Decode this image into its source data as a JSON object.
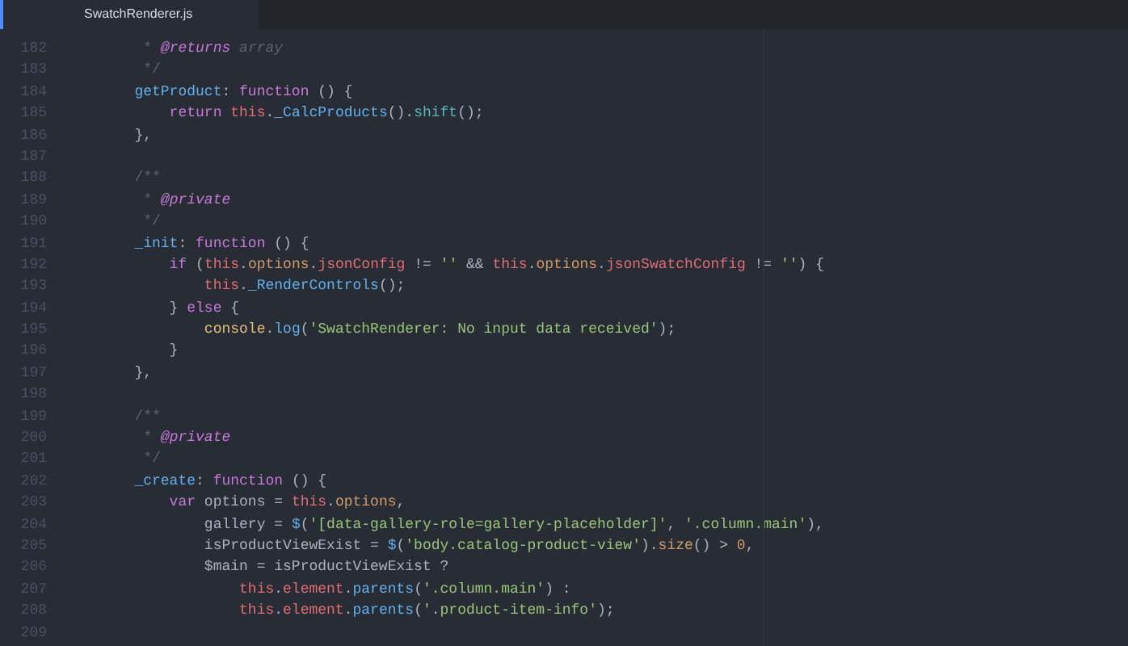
{
  "tabs": [
    {
      "label": "SwatchRenderer.js",
      "selected": true
    }
  ],
  "lines": [
    {
      "number": "182",
      "tokens": [
        {
          "kind": "comment",
          "text": "         * "
        },
        {
          "kind": "tag",
          "text": "@returns"
        },
        {
          "kind": "ctype",
          "text": " array"
        }
      ]
    },
    {
      "number": "183",
      "tokens": [
        {
          "kind": "comment",
          "text": "         */"
        }
      ]
    },
    {
      "number": "184",
      "tokens": [
        {
          "kind": "func",
          "text": "        getProduct"
        },
        {
          "kind": "plain",
          "text": ": "
        },
        {
          "kind": "keyword",
          "text": "function"
        },
        {
          "kind": "plain",
          "text": " () {"
        }
      ]
    },
    {
      "number": "185",
      "tokens": [
        {
          "kind": "keyword",
          "text": "            return "
        },
        {
          "kind": "this",
          "text": "this"
        },
        {
          "kind": "plain",
          "text": "."
        },
        {
          "kind": "func",
          "text": "_CalcProducts"
        },
        {
          "kind": "plain",
          "text": "()."
        },
        {
          "kind": "method",
          "text": "shift"
        },
        {
          "kind": "plain",
          "text": "();"
        }
      ]
    },
    {
      "number": "186",
      "tokens": [
        {
          "kind": "plain",
          "text": "        },"
        }
      ]
    },
    {
      "number": "187"
    },
    {
      "number": "188",
      "tokens": [
        {
          "kind": "comment",
          "text": "        /**"
        }
      ]
    },
    {
      "number": "189",
      "tokens": [
        {
          "kind": "comment",
          "text": "         * "
        },
        {
          "kind": "tag",
          "text": "@private"
        }
      ]
    },
    {
      "number": "190",
      "tokens": [
        {
          "kind": "comment",
          "text": "         */"
        }
      ]
    },
    {
      "number": "191",
      "tokens": [
        {
          "kind": "func",
          "text": "        _init"
        },
        {
          "kind": "plain",
          "text": ": "
        },
        {
          "kind": "keyword",
          "text": "function"
        },
        {
          "kind": "plain",
          "text": " () {"
        }
      ]
    },
    {
      "number": "192",
      "tokens": [
        {
          "kind": "keyword",
          "text": "            if"
        },
        {
          "kind": "plain",
          "text": " ("
        },
        {
          "kind": "this",
          "text": "this"
        },
        {
          "kind": "plain",
          "text": "."
        },
        {
          "kind": "var",
          "text": "options"
        },
        {
          "kind": "plain",
          "text": "."
        },
        {
          "kind": "this",
          "text": "jsonConfig"
        },
        {
          "kind": "plain",
          "text": " != "
        },
        {
          "kind": "string",
          "text": "''"
        },
        {
          "kind": "plain",
          "text": " && "
        },
        {
          "kind": "this",
          "text": "this"
        },
        {
          "kind": "plain",
          "text": "."
        },
        {
          "kind": "var",
          "text": "options"
        },
        {
          "kind": "plain",
          "text": "."
        },
        {
          "kind": "this",
          "text": "jsonSwatchConfig"
        },
        {
          "kind": "plain",
          "text": " != "
        },
        {
          "kind": "string",
          "text": "''"
        },
        {
          "kind": "plain",
          "text": ") {"
        }
      ]
    },
    {
      "number": "193",
      "tokens": [
        {
          "kind": "this",
          "text": "                this"
        },
        {
          "kind": "plain",
          "text": "."
        },
        {
          "kind": "func",
          "text": "_RenderControls"
        },
        {
          "kind": "plain",
          "text": "();"
        }
      ]
    },
    {
      "number": "194",
      "tokens": [
        {
          "kind": "plain",
          "text": "            } "
        },
        {
          "kind": "keyword",
          "text": "else"
        },
        {
          "kind": "plain",
          "text": " {"
        }
      ]
    },
    {
      "number": "195",
      "tokens": [
        {
          "kind": "object",
          "text": "                console"
        },
        {
          "kind": "plain",
          "text": "."
        },
        {
          "kind": "func",
          "text": "log"
        },
        {
          "kind": "plain",
          "text": "("
        },
        {
          "kind": "string",
          "text": "'SwatchRenderer: No input data received'"
        },
        {
          "kind": "plain",
          "text": ");"
        }
      ]
    },
    {
      "number": "196",
      "tokens": [
        {
          "kind": "plain",
          "text": "            }"
        }
      ]
    },
    {
      "number": "197",
      "tokens": [
        {
          "kind": "plain",
          "text": "        },"
        }
      ]
    },
    {
      "number": "198"
    },
    {
      "number": "199",
      "tokens": [
        {
          "kind": "comment",
          "text": "        /**"
        }
      ]
    },
    {
      "number": "200",
      "tokens": [
        {
          "kind": "comment",
          "text": "         * "
        },
        {
          "kind": "tag",
          "text": "@private"
        }
      ]
    },
    {
      "number": "201",
      "tokens": [
        {
          "kind": "comment",
          "text": "         */"
        }
      ]
    },
    {
      "number": "202",
      "tokens": [
        {
          "kind": "func",
          "text": "        _create"
        },
        {
          "kind": "plain",
          "text": ": "
        },
        {
          "kind": "keyword",
          "text": "function"
        },
        {
          "kind": "plain",
          "text": " () {"
        }
      ]
    },
    {
      "number": "203",
      "tokens": [
        {
          "kind": "keyword",
          "text": "            var"
        },
        {
          "kind": "plain",
          "text": " options = "
        },
        {
          "kind": "this",
          "text": "this"
        },
        {
          "kind": "plain",
          "text": "."
        },
        {
          "kind": "var",
          "text": "options"
        },
        {
          "kind": "plain",
          "text": ","
        }
      ]
    },
    {
      "number": "204",
      "tokens": [
        {
          "kind": "plain",
          "text": "                gallery = "
        },
        {
          "kind": "func",
          "text": "$"
        },
        {
          "kind": "plain",
          "text": "("
        },
        {
          "kind": "string",
          "text": "'[data-gallery-role=gallery-placeholder]'"
        },
        {
          "kind": "plain",
          "text": ", "
        },
        {
          "kind": "string",
          "text": "'.column.main'"
        },
        {
          "kind": "plain",
          "text": "),"
        }
      ]
    },
    {
      "number": "205",
      "tokens": [
        {
          "kind": "plain",
          "text": "                isProductViewExist = "
        },
        {
          "kind": "func",
          "text": "$"
        },
        {
          "kind": "plain",
          "text": "("
        },
        {
          "kind": "string",
          "text": "'body.catalog-product-view'"
        },
        {
          "kind": "plain",
          "text": ")."
        },
        {
          "kind": "var",
          "text": "size"
        },
        {
          "kind": "plain",
          "text": "() > "
        },
        {
          "kind": "number",
          "text": "0"
        },
        {
          "kind": "plain",
          "text": ","
        }
      ]
    },
    {
      "number": "206",
      "tokens": [
        {
          "kind": "plain",
          "text": "                $main = isProductViewExist ?"
        }
      ]
    },
    {
      "number": "207",
      "tokens": [
        {
          "kind": "this",
          "text": "                    this"
        },
        {
          "kind": "plain",
          "text": "."
        },
        {
          "kind": "this",
          "text": "element"
        },
        {
          "kind": "plain",
          "text": "."
        },
        {
          "kind": "func",
          "text": "parents"
        },
        {
          "kind": "plain",
          "text": "("
        },
        {
          "kind": "string",
          "text": "'.column.main'"
        },
        {
          "kind": "plain",
          "text": ") :"
        }
      ]
    },
    {
      "number": "208",
      "tokens": [
        {
          "kind": "this",
          "text": "                    this"
        },
        {
          "kind": "plain",
          "text": "."
        },
        {
          "kind": "this",
          "text": "element"
        },
        {
          "kind": "plain",
          "text": "."
        },
        {
          "kind": "func",
          "text": "parents"
        },
        {
          "kind": "plain",
          "text": "("
        },
        {
          "kind": "string",
          "text": "'.product-item-info'"
        },
        {
          "kind": "plain",
          "text": ");"
        }
      ]
    },
    {
      "number": "209"
    }
  ]
}
